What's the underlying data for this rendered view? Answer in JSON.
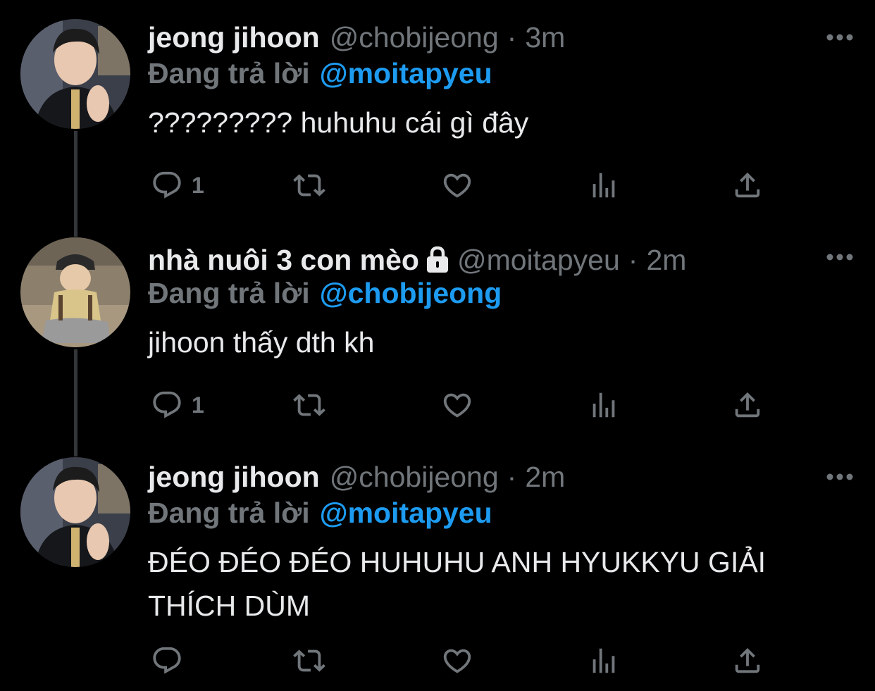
{
  "colors": {
    "background": "#000000",
    "text": "#e7e9ea",
    "secondary": "#71767b",
    "accent": "#1d9bf0",
    "thread_line": "#333639"
  },
  "tweets": [
    {
      "display_name": "jeong jihoon",
      "handle": "@chobijeong",
      "separator": "·",
      "time": "3m",
      "protected": false,
      "replying_prefix": "Đang trả lời",
      "replying_to": "@moitapyeu",
      "text": "????????? huhuhu cái gì đây",
      "reply_count": "1",
      "icons": [
        "more-icon",
        "reply-icon",
        "retweet-icon",
        "like-icon",
        "analytics-icon",
        "share-icon"
      ]
    },
    {
      "display_name": "nhà nuôi 3 con mèo",
      "handle": "@moitapyeu",
      "separator": "·",
      "time": "2m",
      "protected": true,
      "replying_prefix": "Đang trả lời",
      "replying_to": "@chobijeong",
      "text": "jihoon thấy dth kh",
      "reply_count": "1",
      "icons": [
        "lock-icon",
        "more-icon",
        "reply-icon",
        "retweet-icon",
        "like-icon",
        "analytics-icon",
        "share-icon"
      ]
    },
    {
      "display_name": "jeong jihoon",
      "handle": "@chobijeong",
      "separator": "·",
      "time": "2m",
      "protected": false,
      "replying_prefix": "Đang trả lời",
      "replying_to": "@moitapyeu",
      "text": "ĐÉO ĐÉO ĐÉO HUHUHU ANH HYUKKYU GIẢI THÍCH DÙM",
      "reply_count": "",
      "icons": [
        "more-icon",
        "reply-icon",
        "retweet-icon",
        "like-icon",
        "analytics-icon",
        "share-icon"
      ]
    }
  ]
}
